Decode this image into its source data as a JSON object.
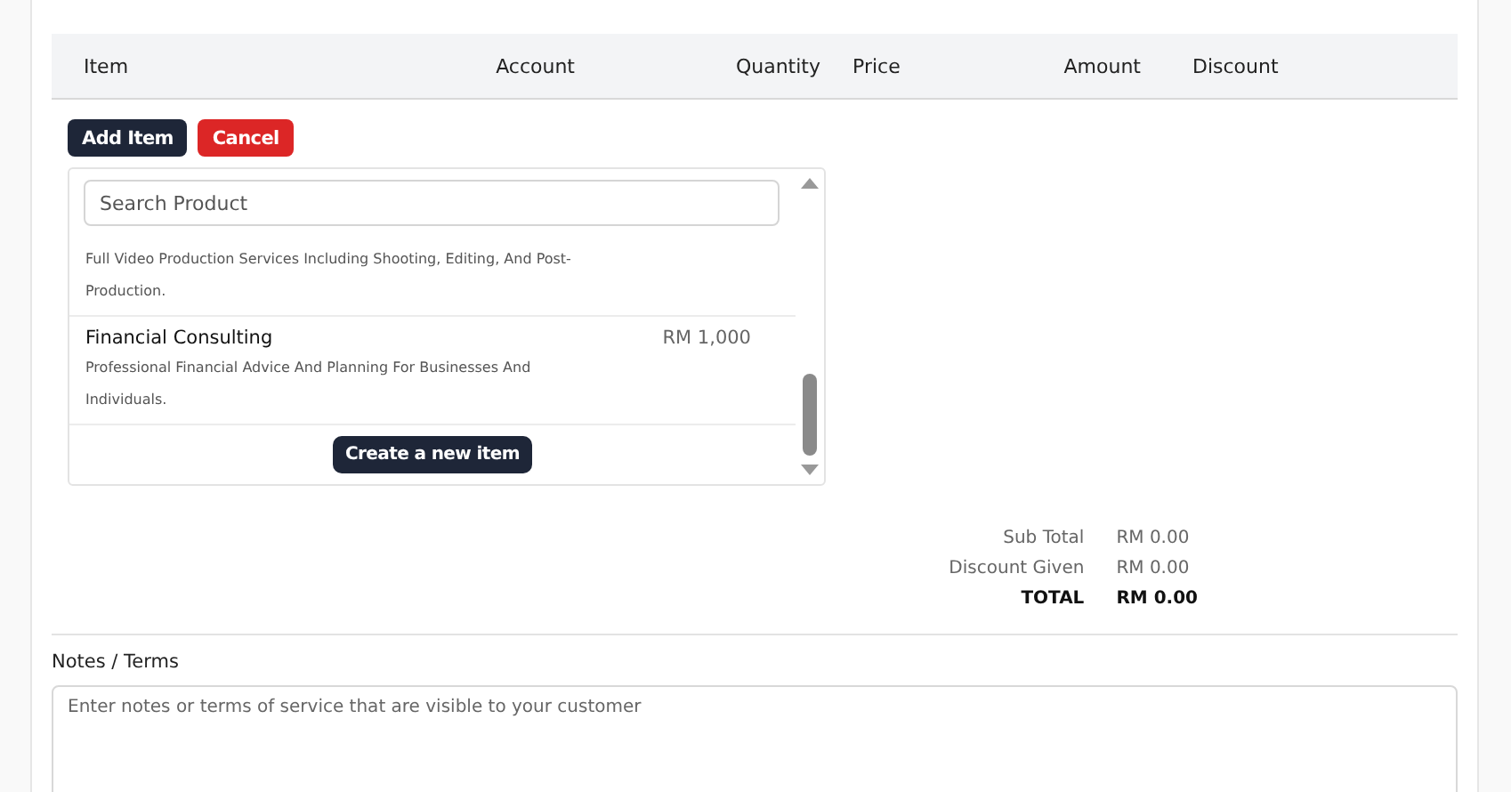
{
  "table": {
    "columns": [
      "Item",
      "Account",
      "Quantity",
      "Price",
      "Amount",
      "Discount"
    ]
  },
  "actions": [
    {
      "label": "Add Item",
      "kind": "primary"
    },
    {
      "label": "Cancel",
      "kind": "danger"
    }
  ],
  "product_picker": {
    "search": {
      "placeholder": "Search Product"
    },
    "items": [
      {
        "description": "Full Video Production Services Including Shooting, Editing, And Post-Production."
      },
      {
        "name": "Financial Consulting",
        "price": "RM 1,000",
        "description": "Professional Financial Advice And Planning For Businesses And Individuals."
      }
    ],
    "create_button": "Create a new item"
  },
  "totals": [
    {
      "label": "Sub Total",
      "value": "RM 0.00",
      "kind": "normal"
    },
    {
      "label": "Discount Given",
      "value": "RM 0.00",
      "kind": "normal"
    },
    {
      "label": "TOTAL",
      "value": "RM 0.00",
      "kind": "total"
    }
  ],
  "notes": {
    "label": "Notes / Terms",
    "placeholder": "Enter notes or terms of service that are visible to your customer"
  }
}
